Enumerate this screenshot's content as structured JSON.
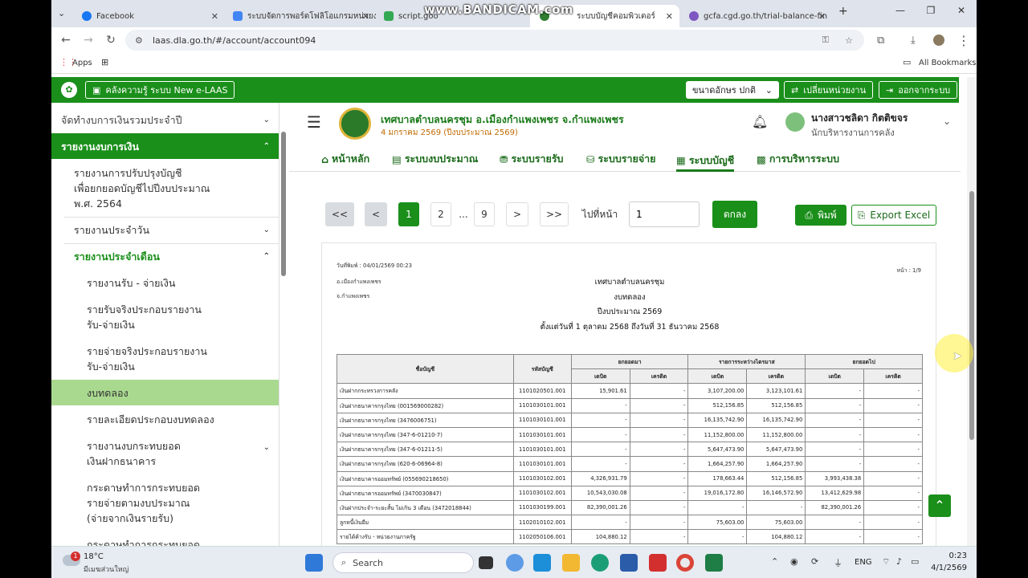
{
  "browser": {
    "tabs": [
      {
        "label": "Facebook",
        "color": "#1877f2"
      },
      {
        "label": "ระบบจัดการพอร์ตโฟลิโอแกรมหน่วยง",
        "color": "#4285f4"
      },
      {
        "label": "script.goo",
        "color": "#34a853"
      },
      {
        "label": "ระบบบัญชีคอมพิวเตอร์",
        "color": "#2e7d32"
      },
      {
        "label": "gcfa.cgd.go.th/trial-balance-fin",
        "color": "#7e57c2"
      }
    ],
    "watermark": "www.BANDICAM.com",
    "url": "laas.dla.go.th/#/account/account094",
    "apps_label": "Apps",
    "bookmarks_label": "All Bookmarks"
  },
  "header": {
    "knowledge_label": "คลังความรู้ ระบบ New e-LAAS",
    "font_size_label": "ขนาดอักษร ปกติ",
    "change_unit_label": "เปลี่ยนหน่วยงาน",
    "logout_label": "ออกจากระบบ",
    "org_name": "เทศบาลตำบลนครชุม อ.เมืองกำแพงเพชร จ.กำแพงเพชร",
    "org_date": "4 มกราคม 2569 (ปีงบประมาณ 2569)",
    "user_name": "นางสาวชลิดา กิตติขจร",
    "user_role": "นักบริหารงานการคลัง"
  },
  "nav_tabs": [
    "หน้าหลัก",
    "ระบบงบประมาณ",
    "ระบบรายรับ",
    "ระบบรายจ่าย",
    "ระบบบัญชี",
    "การบริหารระบบ"
  ],
  "sidebar": {
    "items": [
      {
        "label": "จัดทำงบการเงินรวมประจำปี"
      },
      {
        "label": "รายงานงบการเงิน"
      },
      {
        "label": "รายงานการปรับปรุงบัญชี\nเพื่อยกยอดบัญชีไปปีงบประมาณ\nพ.ศ. 2564"
      },
      {
        "label": "รายงานประจำวัน"
      },
      {
        "label": "รายงานประจำเดือน"
      },
      {
        "label": "รายงานรับ - จ่ายเงิน"
      },
      {
        "label": "รายรับจริงประกอบรายงาน\nรับ-จ่ายเงิน"
      },
      {
        "label": "รายจ่ายจริงประกอบรายงาน\nรับ-จ่ายเงิน"
      },
      {
        "label": "งบทดลอง"
      },
      {
        "label": "รายละเอียดประกอบงบทดลอง"
      },
      {
        "label": "รายงานงบกระทบยอด\nเงินฝากธนาคาร"
      },
      {
        "label": "กระดาษทำการกระทบยอด\nรายจ่ายตามงบประมาณ\n(จ่ายจากเงินรายรับ)"
      },
      {
        "label": "กระดาษทำการกระทบยอด"
      }
    ]
  },
  "pagination": {
    "first": "<<",
    "prev": "<",
    "pages": [
      "1",
      "2",
      "...",
      "9"
    ],
    "next": ">",
    "last": ">>",
    "goto_label": "ไปที่หน้า",
    "goto_value": "1",
    "ok_label": "ตกลง",
    "print_label": "พิมพ์",
    "export_label": "Export Excel"
  },
  "report": {
    "print_date": "วันที่พิมพ์ : 04/01/2569 00:23",
    "page_no": "หน้า : 1/9",
    "district": "อ.เมืองกำแพงเพชร",
    "province": "จ.กำแพงเพชร",
    "org": "เทศบาลตำบลนครชุม",
    "title": "งบทดลอง",
    "fiscal": "ปีงบประมาณ 2569",
    "period": "ตั้งแต่วันที่ 1 ตุลาคม 2568 ถึงวันที่ 31 ธันวาคม 2568",
    "headers": {
      "account": "ชื่อบัญชี",
      "code": "รหัสบัญชี",
      "bf": "ยกยอดมา",
      "mid": "รายการระหว่างไตรมาส",
      "cf": "ยกยอดไป",
      "debit": "เดบิต",
      "credit": "เครดิต"
    },
    "rows": [
      {
        "name": "เงินฝากกระทรวงการคลัง",
        "code": "1101020501.001",
        "c1": "15,901.61",
        "c2": "-",
        "c3": "3,107,200.00",
        "c4": "3,123,101.61",
        "c5": "-",
        "c6": "-"
      },
      {
        "name": "เงินฝากธนาคารกรุงไทย (001569000282)",
        "code": "1101030101.001",
        "c1": "-",
        "c2": "-",
        "c3": "512,156.85",
        "c4": "512,156.85",
        "c5": "-",
        "c6": "-"
      },
      {
        "name": "เงินฝากธนาคารกรุงไทย (3476006751)",
        "code": "1101030101.001",
        "c1": "-",
        "c2": "-",
        "c3": "16,135,742.90",
        "c4": "16,135,742.90",
        "c5": "-",
        "c6": "-"
      },
      {
        "name": "เงินฝากธนาคารกรุงไทย (347-6-01210-7)",
        "code": "1101030101.001",
        "c1": "-",
        "c2": "-",
        "c3": "11,152,800.00",
        "c4": "11,152,800.00",
        "c5": "-",
        "c6": "-"
      },
      {
        "name": "เงินฝากธนาคารกรุงไทย (347-6-01211-5)",
        "code": "1101030101.001",
        "c1": "-",
        "c2": "-",
        "c3": "5,647,473.90",
        "c4": "5,647,473.90",
        "c5": "-",
        "c6": "-"
      },
      {
        "name": "เงินฝากธนาคารกรุงไทย (620-6-06964-8)",
        "code": "1101030101.001",
        "c1": "-",
        "c2": "-",
        "c3": "1,664,257.90",
        "c4": "1,664,257.90",
        "c5": "-",
        "c6": "-"
      },
      {
        "name": "เงินฝากธนาคารออมทรัพย์ (055690218650)",
        "code": "1101030102.001",
        "c1": "4,326,931.79",
        "c2": "-",
        "c3": "178,663.44",
        "c4": "512,156.85",
        "c5": "3,993,438.38",
        "c6": "-"
      },
      {
        "name": "เงินฝากธนาคารออมทรัพย์ (3470030847)",
        "code": "1101030102.001",
        "c1": "10,543,030.08",
        "c2": "-",
        "c3": "19,016,172.80",
        "c4": "16,146,572.90",
        "c5": "13,412,629.98",
        "c6": "-"
      },
      {
        "name": "เงินฝากประจำ-ระยะสั้น ไม่เกิน 3 เดือน (3472018844)",
        "code": "1101030199.001",
        "c1": "82,390,001.26",
        "c2": "-",
        "c3": "-",
        "c4": "-",
        "c5": "82,390,001.26",
        "c6": "-"
      },
      {
        "name": "ลูกหนี้เงินยืม",
        "code": "1102010102.001",
        "c1": "-",
        "c2": "-",
        "c3": "75,603.00",
        "c4": "75,603.00",
        "c5": "-",
        "c6": "-"
      },
      {
        "name": "รายได้ค้างรับ - หน่วยงานภาครัฐ",
        "code": "1102050106.001",
        "c1": "104,880.12",
        "c2": "-",
        "c3": "-",
        "c4": "104,880.12",
        "c5": "-",
        "c6": "-"
      }
    ]
  },
  "taskbar": {
    "weather_temp": "18°C",
    "weather_desc": "มีเมฆส่วนใหญ่",
    "search_label": "Search",
    "lang": "ENG",
    "time": "0:23",
    "date": "4/1/2569",
    "badge": "1"
  }
}
